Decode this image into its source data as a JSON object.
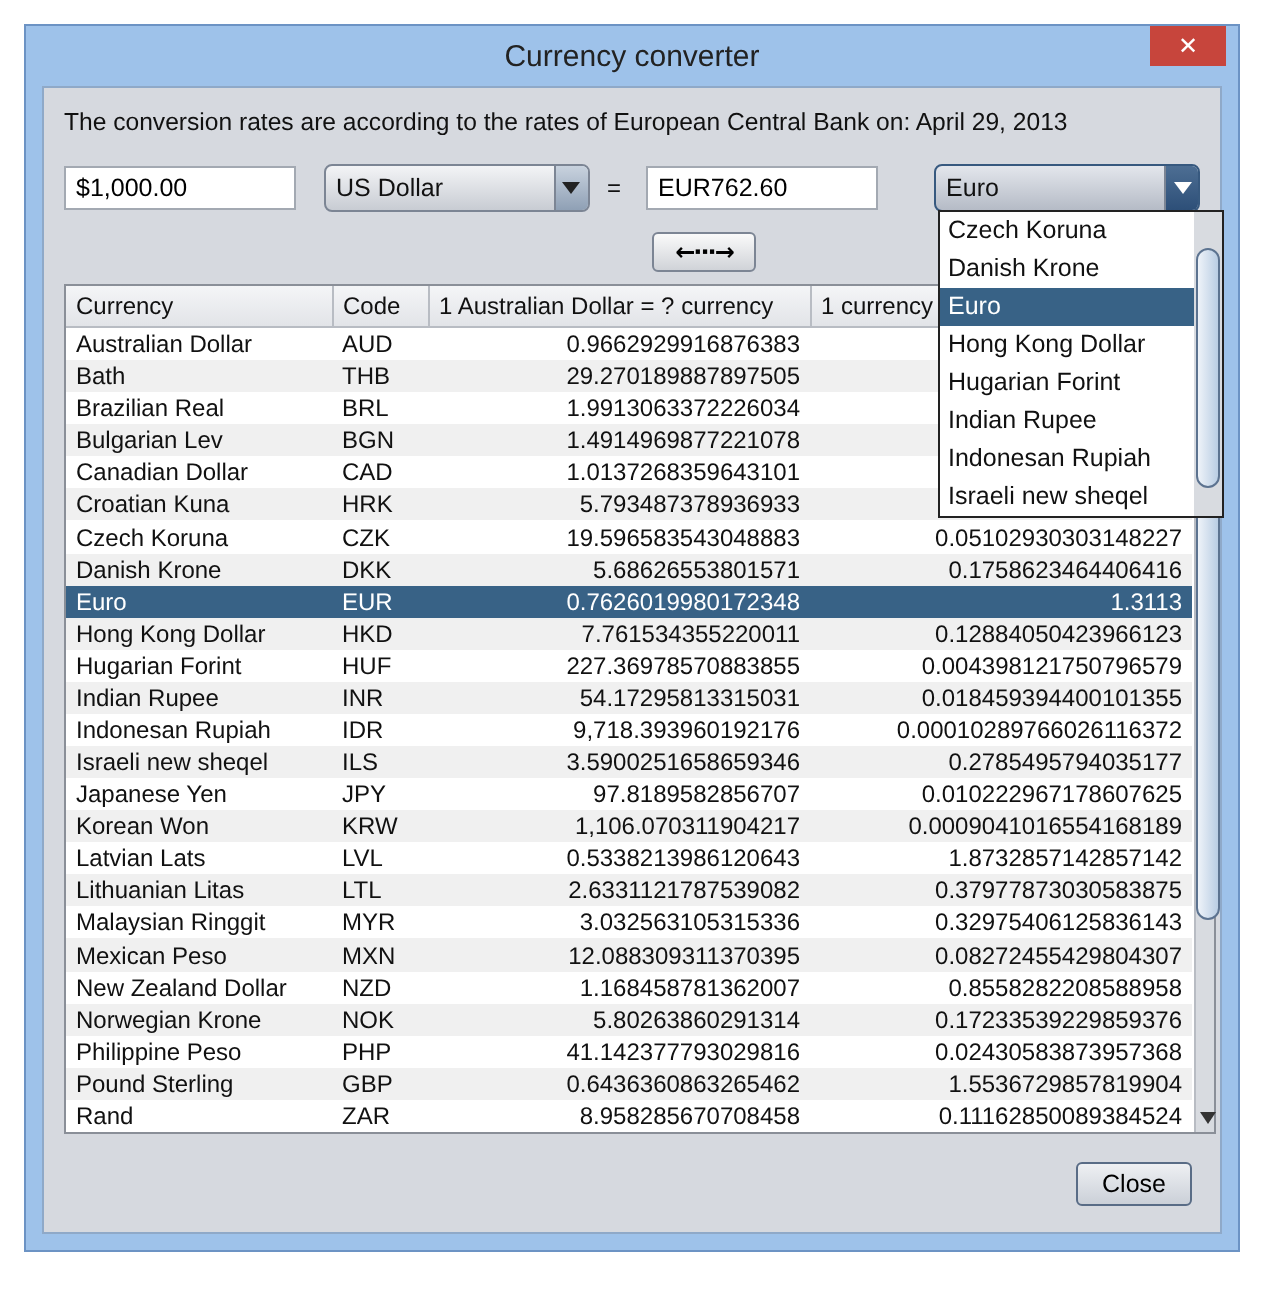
{
  "window": {
    "title": "Currency converter",
    "close": "✕"
  },
  "info": "The conversion rates are according to the rates of European Central Bank on: April 29, 2013",
  "from": {
    "amount": "$1,000.00",
    "currency": "US Dollar"
  },
  "equals": "=",
  "to": {
    "amount": "EUR762.60",
    "currency": "Euro"
  },
  "swap_button": "←···→",
  "dropdown": {
    "items": [
      {
        "label": "Czech Koruna",
        "selected": false
      },
      {
        "label": "Danish Krone",
        "selected": false
      },
      {
        "label": "Euro",
        "selected": true
      },
      {
        "label": "Hong Kong Dollar",
        "selected": false
      },
      {
        "label": "Hugarian Forint",
        "selected": false
      },
      {
        "label": "Indian Rupee",
        "selected": false
      },
      {
        "label": "Indonesan Rupiah",
        "selected": false
      },
      {
        "label": "Israeli new sheqel",
        "selected": false
      }
    ]
  },
  "table": {
    "columns": [
      "Currency",
      "Code",
      "1 Australian Dollar = ? currency",
      "1 currency"
    ],
    "rows": [
      {
        "currency": "Australian Dollar",
        "code": "AUD",
        "rate": "0.9662929916876383",
        "selected": false
      },
      {
        "currency": "Bath",
        "code": "THB",
        "rate": "29.270189887897505",
        "selected": false
      },
      {
        "currency": "Brazilian Real",
        "code": "BRL",
        "rate": "1.9913063372226034",
        "selected": false
      },
      {
        "currency": "Bulgarian Lev",
        "code": "BGN",
        "rate": "1.4914969877221078",
        "selected": false
      },
      {
        "currency": "Canadian Dollar",
        "code": "CAD",
        "rate": "1.0137268359643101",
        "selected": false
      },
      {
        "currency": "Croatian Kuna",
        "code": "HRK",
        "rate": "5.793487378936933",
        "selected": false
      },
      {
        "currency": "Czech Koruna",
        "code": "CZK",
        "rate": "19.596583543048883",
        "inverse": "0.05102930303148227",
        "selected": false
      },
      {
        "currency": "Danish Krone",
        "code": "DKK",
        "rate": "5.68626553801571",
        "inverse": "0.1758623464406416",
        "selected": false
      },
      {
        "currency": "Euro",
        "code": "EUR",
        "rate": "0.7626019980172348",
        "inverse": "1.3113",
        "selected": true
      },
      {
        "currency": "Hong Kong Dollar",
        "code": "HKD",
        "rate": "7.761534355220011",
        "inverse": "0.12884050423966123",
        "selected": false
      },
      {
        "currency": "Hugarian Forint",
        "code": "HUF",
        "rate": "227.36978570883855",
        "inverse": "0.004398121750796579",
        "selected": false
      },
      {
        "currency": "Indian Rupee",
        "code": "INR",
        "rate": "54.17295813315031",
        "inverse": "0.018459394400101355",
        "selected": false
      },
      {
        "currency": "Indonesan Rupiah",
        "code": "IDR",
        "rate": "9,718.393960192176",
        "inverse": "0.00010289766026116372",
        "selected": false
      },
      {
        "currency": "Israeli new sheqel",
        "code": "ILS",
        "rate": "3.5900251658659346",
        "inverse": "0.2785495794035177",
        "selected": false
      },
      {
        "currency": "Japanese Yen",
        "code": "JPY",
        "rate": "97.8189582856707",
        "inverse": "0.010222967178607625",
        "selected": false
      },
      {
        "currency": "Korean Won",
        "code": "KRW",
        "rate": "1,106.070311904217",
        "inverse": "0.0009041016554168189",
        "selected": false
      },
      {
        "currency": "Latvian Lats",
        "code": "LVL",
        "rate": "0.5338213986120643",
        "inverse": "1.8732857142857142",
        "selected": false
      },
      {
        "currency": "Lithuanian Litas",
        "code": "LTL",
        "rate": "2.6331121787539082",
        "inverse": "0.37977873030583875",
        "selected": false
      },
      {
        "currency": "Malaysian Ringgit",
        "code": "MYR",
        "rate": "3.032563105315336",
        "inverse": "0.32975406125836143",
        "selected": false
      },
      {
        "currency": "Mexican Peso",
        "code": "MXN",
        "rate": "12.088309311370395",
        "inverse": "0.08272455429804307",
        "selected": false
      },
      {
        "currency": "New Zealand Dollar",
        "code": "NZD",
        "rate": "1.168458781362007",
        "inverse": "0.8558282208588958",
        "selected": false
      },
      {
        "currency": "Norwegian Krone",
        "code": "NOK",
        "rate": "5.80263860291314",
        "inverse": "0.17233539229859376",
        "selected": false
      },
      {
        "currency": "Philippine Peso",
        "code": "PHP",
        "rate": "41.142377793029816",
        "inverse": "0.02430583873957368",
        "selected": false
      },
      {
        "currency": "Pound Sterling",
        "code": "GBP",
        "rate": "0.6436360863265462",
        "inverse": "1.5536729857819904",
        "selected": false
      },
      {
        "currency": "Rand",
        "code": "ZAR",
        "rate": "8.958285670708458",
        "inverse": "0.11162850089384524",
        "selected": false
      }
    ]
  },
  "close_button": "Close"
}
